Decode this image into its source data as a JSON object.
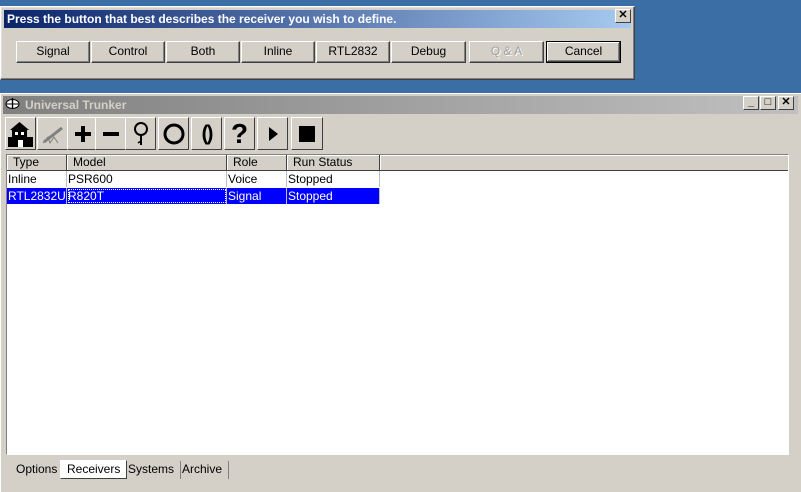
{
  "dialog": {
    "title": "Press the button that best describes the receiver you wish to define.",
    "close_glyph": "✕",
    "buttons": [
      "Signal",
      "Control",
      "Both",
      "Inline",
      "RTL2832",
      "Debug",
      "Q & A",
      "Cancel"
    ]
  },
  "window": {
    "title": "Universal Trunker",
    "min_glyph": "_",
    "max_glyph": "□",
    "close_glyph": "✕"
  },
  "toolbar": {
    "icons": [
      "receiver-house-icon",
      "edit-pencil-icon",
      "plus-icon",
      "minus-icon",
      "magnifier-icon",
      "circle-icon",
      "parentheses-icon",
      "question-icon",
      "play-icon",
      "stop-icon"
    ],
    "question_glyph": "?",
    "parens_glyph": "()"
  },
  "table": {
    "columns": [
      "Type",
      "Model",
      "Role",
      "Run Status"
    ],
    "rows": [
      [
        "Inline",
        "PSR600",
        "Voice",
        "Stopped"
      ],
      [
        "RTL2832U",
        "R820T",
        "Signal",
        "Stopped"
      ]
    ],
    "selected_row": 1
  },
  "tabs": [
    "Options",
    "Receivers",
    "Systems",
    "Archive"
  ],
  "active_tab": "Receivers",
  "colors": {
    "desktop": "#3a6ea5",
    "selection": "#0000ff",
    "dialog_title_start": "#0a246a",
    "dialog_title_end": "#a6caf0"
  }
}
